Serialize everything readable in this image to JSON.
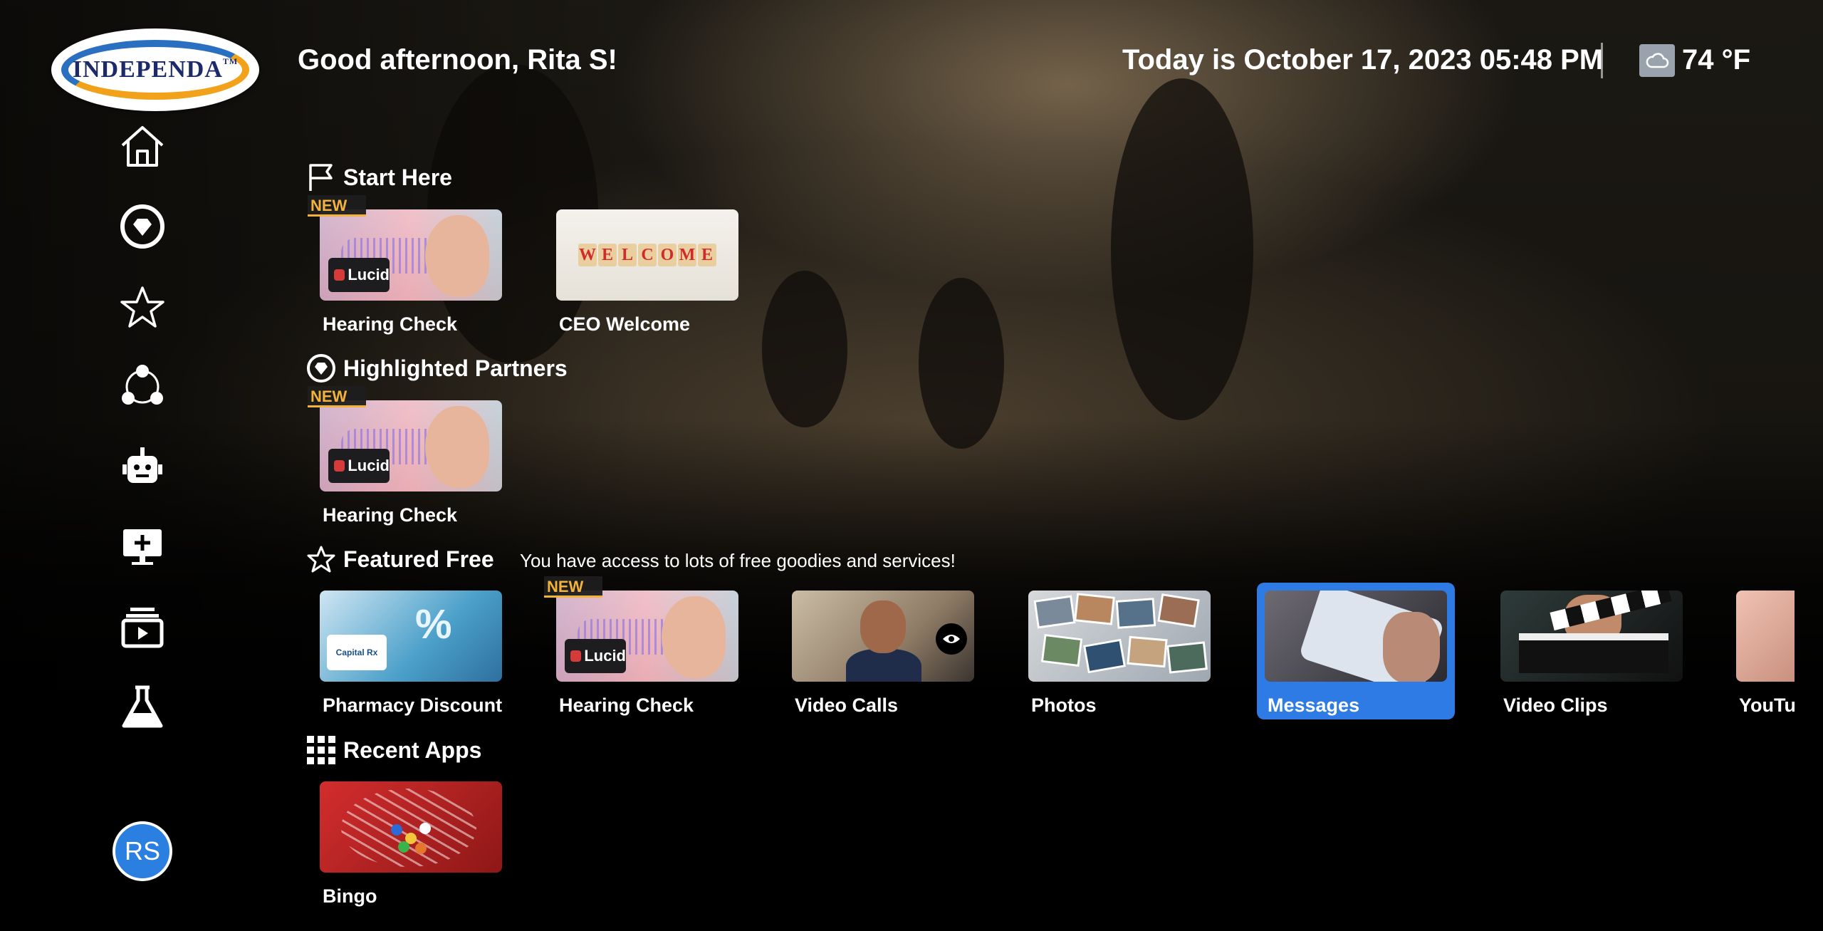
{
  "header": {
    "logo_text": "INDEPENDA",
    "logo_tm": "TM",
    "greeting": "Good afternoon, Rita S!",
    "datetime": "Today is October 17, 2023 05:48 PM",
    "weather_icon": "cloud-icon",
    "temperature": "74 °F"
  },
  "sidebar": {
    "items": [
      {
        "name": "home",
        "icon": "home-icon"
      },
      {
        "name": "partners",
        "icon": "heart-badge-icon"
      },
      {
        "name": "featured",
        "icon": "star-icon"
      },
      {
        "name": "community",
        "icon": "people-circle-icon"
      },
      {
        "name": "assistant",
        "icon": "robot-icon"
      },
      {
        "name": "screen",
        "icon": "monitor-plus-icon"
      },
      {
        "name": "media",
        "icon": "media-stack-icon"
      },
      {
        "name": "lab",
        "icon": "flask-icon"
      }
    ],
    "avatar_initials": "RS"
  },
  "sections": {
    "start_here": {
      "title": "Start Here",
      "cards": [
        {
          "label": "Hearing Check",
          "badge": "NEW"
        },
        {
          "label": "CEO Welcome",
          "welcome_text": "WELCOME"
        }
      ]
    },
    "highlighted_partners": {
      "title": "Highlighted Partners",
      "cards": [
        {
          "label": "Hearing Check",
          "badge": "NEW"
        }
      ]
    },
    "featured_free": {
      "title": "Featured Free",
      "subtitle": "You have access to lots of free goodies and services!",
      "cards": [
        {
          "label": "Pharmacy Discount",
          "pct": "%",
          "brand": "Capital Rx"
        },
        {
          "label": "Hearing Check",
          "badge": "NEW"
        },
        {
          "label": "Video Calls"
        },
        {
          "label": "Photos"
        },
        {
          "label": "Messages",
          "selected": true
        },
        {
          "label": "Video Clips"
        },
        {
          "label": "YouTul"
        }
      ]
    },
    "recent_apps": {
      "title": "Recent Apps",
      "cards": [
        {
          "label": "Bingo"
        }
      ]
    }
  },
  "lucid_text": "Lucid",
  "colors": {
    "accent_blue": "#2f7be6",
    "badge_gold": "#f3b23b",
    "avatar_blue": "#2a7fe0"
  }
}
